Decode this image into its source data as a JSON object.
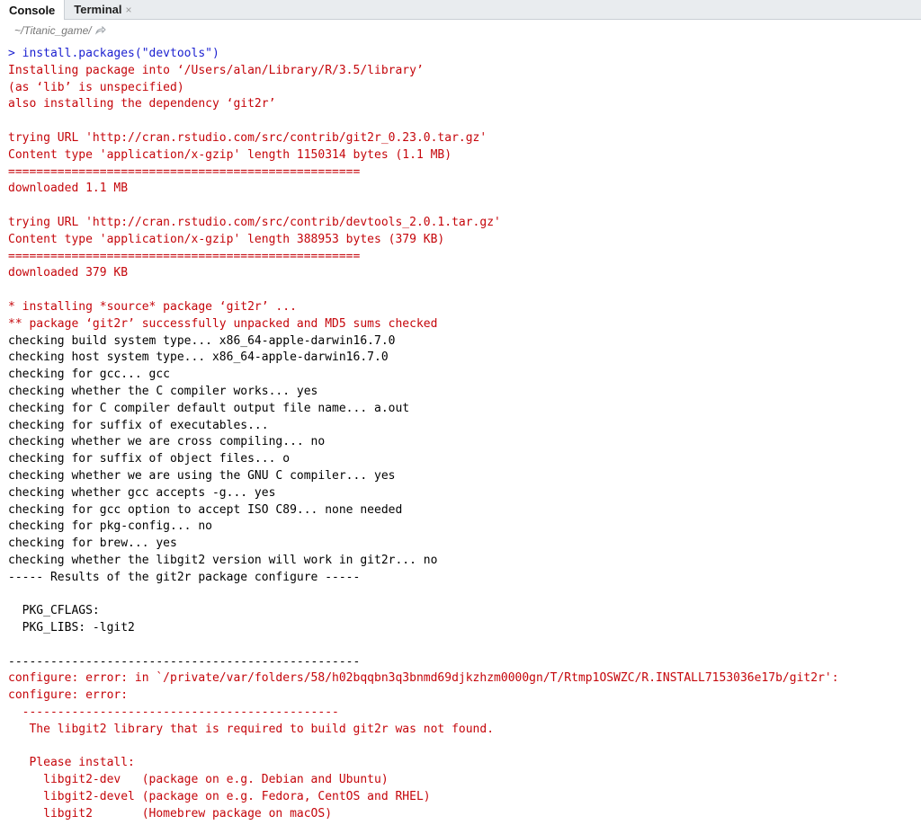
{
  "tabs": {
    "console_label": "Console",
    "terminal_label": "Terminal",
    "close_glyph": "×"
  },
  "path": {
    "working_dir": "~/Titanic_game/",
    "icon": "arrow-forward-icon"
  },
  "colors": {
    "command": "#1a1fd0",
    "message": "#c5060b",
    "output": "#000000"
  },
  "console_lines": [
    {
      "type": "cmd",
      "text": "> install.packages(\"devtools\")"
    },
    {
      "type": "msg",
      "text": "Installing package into ‘/Users/alan/Library/R/3.5/library’"
    },
    {
      "type": "msg",
      "text": "(as ‘lib’ is unspecified)"
    },
    {
      "type": "msg",
      "text": "also installing the dependency ‘git2r’"
    },
    {
      "type": "blank",
      "text": ""
    },
    {
      "type": "msg",
      "text": "trying URL 'http://cran.rstudio.com/src/contrib/git2r_0.23.0.tar.gz'"
    },
    {
      "type": "msg",
      "text": "Content type 'application/x-gzip' length 1150314 bytes (1.1 MB)"
    },
    {
      "type": "msg",
      "text": "=================================================="
    },
    {
      "type": "msg",
      "text": "downloaded 1.1 MB"
    },
    {
      "type": "blank",
      "text": ""
    },
    {
      "type": "msg",
      "text": "trying URL 'http://cran.rstudio.com/src/contrib/devtools_2.0.1.tar.gz'"
    },
    {
      "type": "msg",
      "text": "Content type 'application/x-gzip' length 388953 bytes (379 KB)"
    },
    {
      "type": "msg",
      "text": "=================================================="
    },
    {
      "type": "msg",
      "text": "downloaded 379 KB"
    },
    {
      "type": "blank",
      "text": ""
    },
    {
      "type": "msg",
      "text": "* installing *source* package ‘git2r’ ..."
    },
    {
      "type": "msg",
      "text": "** package ‘git2r’ successfully unpacked and MD5 sums checked"
    },
    {
      "type": "out",
      "text": "checking build system type... x86_64-apple-darwin16.7.0"
    },
    {
      "type": "out",
      "text": "checking host system type... x86_64-apple-darwin16.7.0"
    },
    {
      "type": "out",
      "text": "checking for gcc... gcc"
    },
    {
      "type": "out",
      "text": "checking whether the C compiler works... yes"
    },
    {
      "type": "out",
      "text": "checking for C compiler default output file name... a.out"
    },
    {
      "type": "out",
      "text": "checking for suffix of executables..."
    },
    {
      "type": "out",
      "text": "checking whether we are cross compiling... no"
    },
    {
      "type": "out",
      "text": "checking for suffix of object files... o"
    },
    {
      "type": "out",
      "text": "checking whether we are using the GNU C compiler... yes"
    },
    {
      "type": "out",
      "text": "checking whether gcc accepts -g... yes"
    },
    {
      "type": "out",
      "text": "checking for gcc option to accept ISO C89... none needed"
    },
    {
      "type": "out",
      "text": "checking for pkg-config... no"
    },
    {
      "type": "out",
      "text": "checking for brew... yes"
    },
    {
      "type": "out",
      "text": "checking whether the libgit2 version will work in git2r... no"
    },
    {
      "type": "out",
      "text": "----- Results of the git2r package configure -----"
    },
    {
      "type": "blank",
      "text": ""
    },
    {
      "type": "out",
      "text": "  PKG_CFLAGS:"
    },
    {
      "type": "out",
      "text": "  PKG_LIBS: -lgit2"
    },
    {
      "type": "blank",
      "text": ""
    },
    {
      "type": "out",
      "text": "--------------------------------------------------"
    },
    {
      "type": "msg",
      "text": "configure: error: in `/private/var/folders/58/h02bqqbn3q3bnmd69djkzhzm0000gn/T/Rtmp1OSWZC/R.INSTALL7153036e17b/git2r':"
    },
    {
      "type": "msg",
      "text": "configure: error:"
    },
    {
      "type": "msg",
      "text": "  ---------------------------------------------"
    },
    {
      "type": "msg",
      "text": "   The libgit2 library that is required to build git2r was not found."
    },
    {
      "type": "blank",
      "text": ""
    },
    {
      "type": "msg",
      "text": "   Please install:"
    },
    {
      "type": "msg",
      "text": "     libgit2-dev   (package on e.g. Debian and Ubuntu)"
    },
    {
      "type": "msg",
      "text": "     libgit2-devel (package on e.g. Fedora, CentOS and RHEL)"
    },
    {
      "type": "msg",
      "text": "     libgit2       (Homebrew package on macOS)"
    }
  ]
}
